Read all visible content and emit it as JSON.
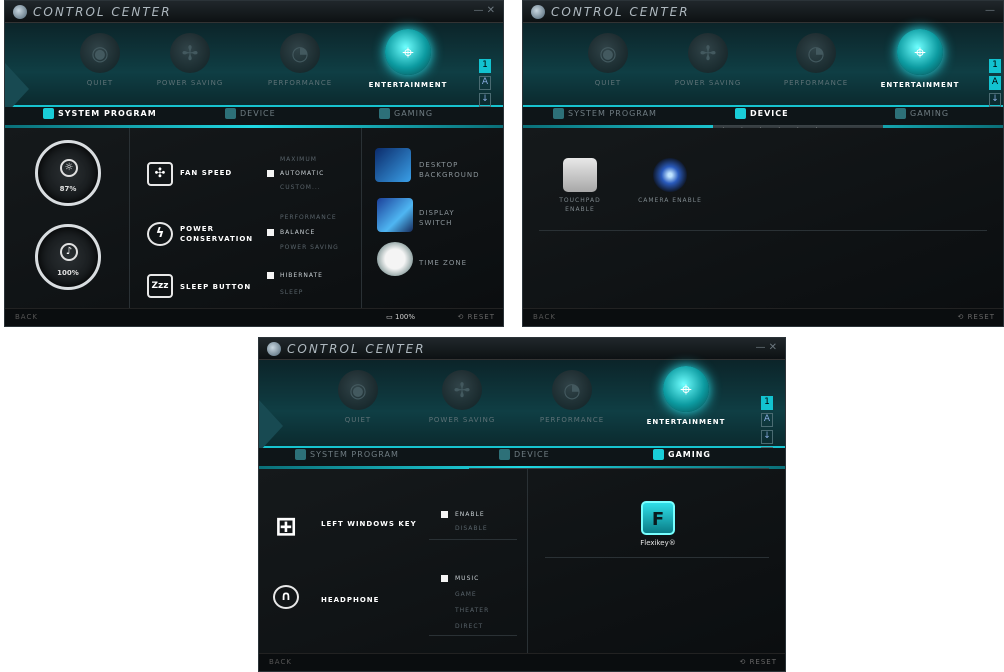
{
  "app": {
    "title": "CONTROL CENTER"
  },
  "modes": [
    {
      "label": "QUIET",
      "icon": "quiet-icon"
    },
    {
      "label": "POWER SAVING",
      "icon": "power-saving-icon"
    },
    {
      "label": "PERFORMANCE",
      "icon": "performance-icon"
    },
    {
      "label": "ENTERTAINMENT",
      "icon": "entertainment-icon"
    }
  ],
  "tabs": {
    "system": "SYSTEM PROGRAM",
    "device": "DEVICE",
    "gaming": "GAMING"
  },
  "side_icons": [
    "1",
    "A",
    "↓",
    "✈"
  ],
  "status": {
    "back": "BACK",
    "reset": "RESET",
    "battery": "100%"
  },
  "system_program": {
    "gauges": [
      {
        "name": "brightness",
        "value": "87%"
      },
      {
        "name": "volume",
        "value": "100%"
      }
    ],
    "fan": {
      "label": "FAN SPEED",
      "options": [
        "MAXIMUM",
        "AUTOMATIC",
        "CUSTOM..."
      ],
      "selected": "AUTOMATIC"
    },
    "power": {
      "label": "POWER CONSERVATION",
      "options": [
        "PERFORMANCE",
        "BALANCE",
        "POWER SAVING"
      ],
      "selected": "BALANCE"
    },
    "sleep": {
      "label": "SLEEP BUTTON",
      "icon_text": "Zzz",
      "options": [
        "HIBERNATE",
        "SLEEP"
      ],
      "selected": "HIBERNATE"
    },
    "right_items": [
      {
        "label": "DESKTOP BACKGROUND",
        "icon": "desktop-background-icon"
      },
      {
        "label": "DISPLAY SWITCH",
        "icon": "display-switch-icon"
      },
      {
        "label": "TIME ZONE",
        "icon": "time-zone-icon"
      }
    ]
  },
  "device": {
    "items": [
      {
        "label": "TOUCHPAD ENABLE",
        "icon": "touchpad-icon"
      },
      {
        "label": "CAMERA ENABLE",
        "icon": "camera-icon"
      }
    ]
  },
  "gaming": {
    "windows_key": {
      "label": "LEFT WINDOWS KEY",
      "options": [
        "ENABLE",
        "DISABLE"
      ],
      "selected": "ENABLE"
    },
    "headphone": {
      "label": "HEADPHONE",
      "options": [
        "MUSIC",
        "GAME",
        "THEATER",
        "DIRECT"
      ],
      "selected": "MUSIC"
    },
    "flexikey": {
      "label": "Flexikey®",
      "icon_text": "F"
    }
  },
  "colors": {
    "accent": "#17c3cf",
    "background": "#111518"
  }
}
